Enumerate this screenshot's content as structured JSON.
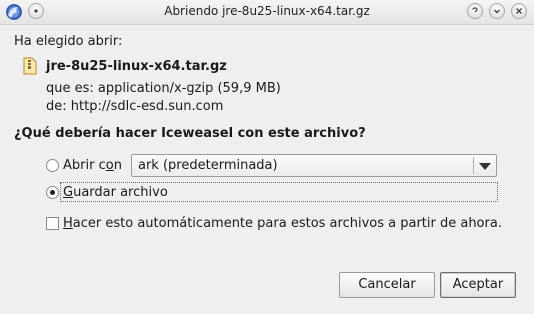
{
  "window": {
    "title": "Abriendo jre-8u25-linux-x64.tar.gz"
  },
  "dialog": {
    "intro": "Ha elegido abrir:",
    "filename": "jre-8u25-linux-x64.tar.gz",
    "type_line": "que es: application/x-gzip (59,9 MB)",
    "from_line": "de: http://sdlc-esd.sun.com",
    "question": "¿Qué debería hacer Iceweasel con este archivo?",
    "open_with": {
      "label_prefix": "Abrir c",
      "label_mnemonic": "o",
      "label_suffix": "n",
      "selected_app": "ark (predeterminada)"
    },
    "save": {
      "label_mnemonic": "G",
      "label_suffix": "uardar archivo",
      "checked": true
    },
    "auto": {
      "label_mnemonic": "H",
      "label_suffix": "acer esto automáticamente para estos archivos a partir de ahora.",
      "checked": false
    },
    "buttons": {
      "cancel": "Cancelar",
      "accept": "Aceptar"
    }
  },
  "icons": {
    "app": "iceweasel-icon",
    "help": "help-icon",
    "minimize": "minimize-icon",
    "maximize": "maximize-icon",
    "close": "close-icon",
    "file": "archive-file-icon"
  }
}
